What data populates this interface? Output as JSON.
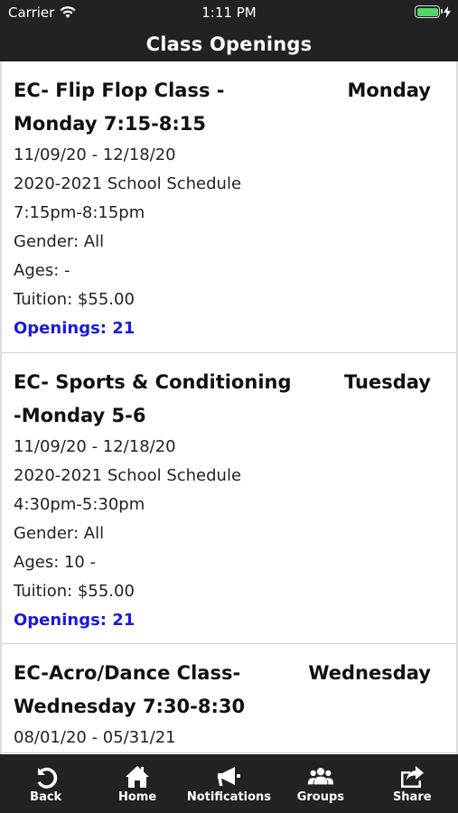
{
  "status": {
    "carrier": "Carrier",
    "time": "1:11 PM"
  },
  "title": "Class Openings",
  "classes": [
    {
      "name": "EC- Flip Flop Class - Monday 7:15-8:15",
      "day": "Monday",
      "dates": "11/09/20 - 12/18/20",
      "schedule": "2020-2021 School Schedule",
      "time": "7:15pm-8:15pm",
      "gender": "Gender: All",
      "ages": "Ages: -",
      "tuition": "Tuition: $55.00",
      "openings": "Openings: 21"
    },
    {
      "name": "EC- Sports & Conditioning -Monday 5-6",
      "day": "Tuesday",
      "dates": "11/09/20 - 12/18/20",
      "schedule": "2020-2021 School Schedule",
      "time": "4:30pm-5:30pm",
      "gender": "Gender: All",
      "ages": "Ages: 10 -",
      "tuition": "Tuition: $55.00",
      "openings": "Openings: 21"
    },
    {
      "name": "EC-Acro/Dance Class- Wednesday 7:30-8:30",
      "day": "Wednesday",
      "dates": "08/01/20 - 05/31/21"
    }
  ],
  "tabs": {
    "back": {
      "label": "Back",
      "icon": "back-arrow-icon"
    },
    "home": {
      "label": "Home",
      "icon": "home-icon"
    },
    "notifications": {
      "label": "Notifications",
      "icon": "megaphone-icon"
    },
    "groups": {
      "label": "Groups",
      "icon": "groups-icon"
    },
    "share": {
      "label": "Share",
      "icon": "share-icon"
    }
  },
  "colors": {
    "bar": "#222222",
    "openings": "#1a1adb",
    "battery": "#4cd964"
  }
}
